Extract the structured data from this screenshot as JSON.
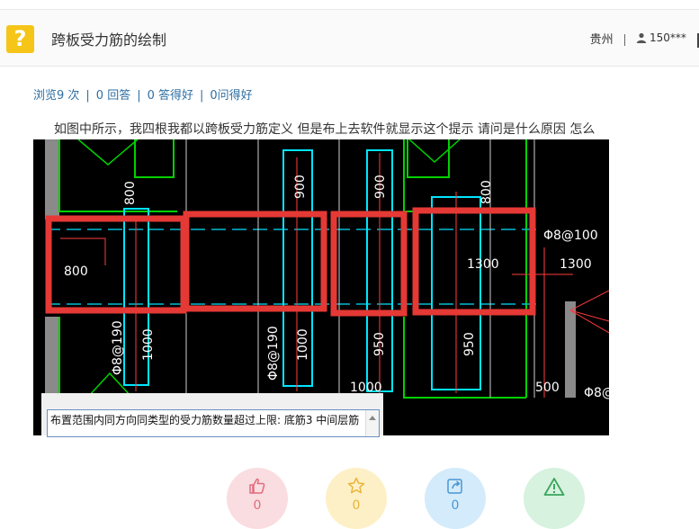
{
  "header": {
    "title": "跨板受力筋的绘制",
    "location": "贵州",
    "user": "150***"
  },
  "stats": {
    "views": "浏览9 次",
    "answers": "0 回答",
    "good_answers": "0 答得好",
    "good_questions": "0问得好"
  },
  "question_text": "如图中所示，我四根我都以跨板受力筋定义     但是布上去软件就显示这个提示    请问是什么原因  怎么",
  "screenshot": {
    "labels": {
      "s800a": "800",
      "s900a": "900",
      "s900b": "900",
      "s800b": "800",
      "phi_left": "Φ8@100",
      "left800": "800",
      "mid1300": "1300",
      "right1300": "1300",
      "v1000a": "1000",
      "v190a": "Φ8@190",
      "v190b": "Φ8@190",
      "v1000b": "1000",
      "v950a": "950",
      "v950b": "950",
      "h1000": "1000",
      "h500": "500",
      "phi_bottom": "Φ8@"
    },
    "dialog_message": "布置范围内同方向同类型的受力筋数量超过上限: 底筋3 中间层筋"
  },
  "actions": {
    "like_count": "0",
    "favorite_count": "0",
    "share_count": "0",
    "report_count": "0"
  },
  "colors": {
    "cad_background": "#000000",
    "highlight_red": "#e53935",
    "cad_cyan": "#00e5ff",
    "cad_green": "#00d200",
    "like_bg": "#f9dde0",
    "favorite_bg": "#fdf0c6",
    "share_bg": "#d4ebfb",
    "report_bg": "#d7f2df"
  }
}
